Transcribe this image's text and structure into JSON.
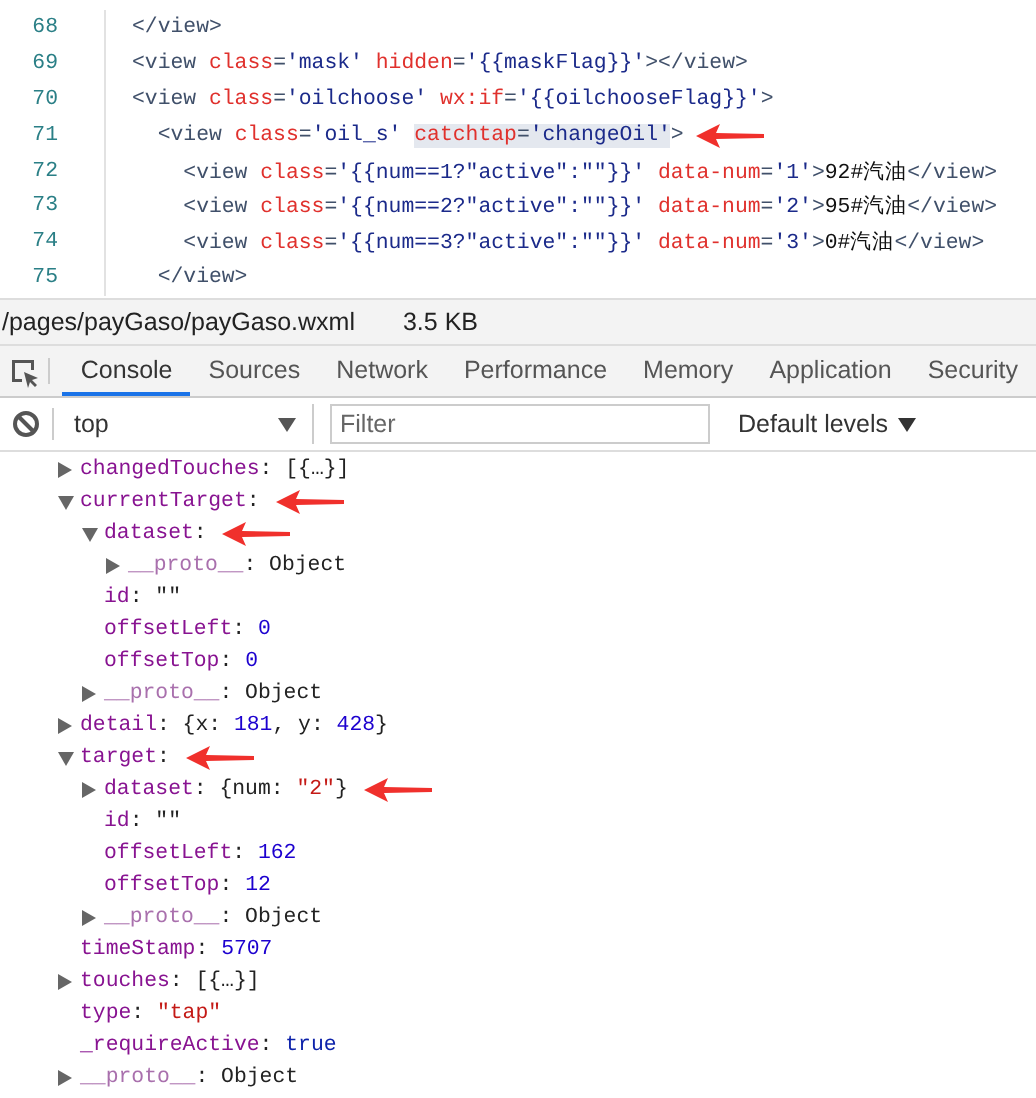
{
  "code_editor": {
    "lines": [
      {
        "number": "68",
        "marked": false,
        "tokens": [
          {
            "kind": "tag",
            "text": "</view>"
          }
        ]
      },
      {
        "number": "69",
        "marked": false,
        "tokens": [
          {
            "kind": "tag",
            "text": "<view "
          },
          {
            "kind": "attr",
            "text": "class"
          },
          {
            "kind": "tag",
            "text": "="
          },
          {
            "kind": "value",
            "text": "'mask' "
          },
          {
            "kind": "attr",
            "text": "hidden"
          },
          {
            "kind": "tag",
            "text": "="
          },
          {
            "kind": "value",
            "text": "'{{maskFlag}}'"
          },
          {
            "kind": "tag",
            "text": "></view>"
          }
        ]
      },
      {
        "number": "70",
        "marked": false,
        "tokens": [
          {
            "kind": "tag",
            "text": "<view "
          },
          {
            "kind": "attr",
            "text": "class"
          },
          {
            "kind": "tag",
            "text": "="
          },
          {
            "kind": "value",
            "text": "'oilchoose' "
          },
          {
            "kind": "attr",
            "text": "wx:if"
          },
          {
            "kind": "tag",
            "text": "="
          },
          {
            "kind": "value",
            "text": "'{{oilchooseFlag}}'"
          },
          {
            "kind": "tag",
            "text": ">"
          }
        ]
      },
      {
        "number": "71",
        "marked": true,
        "tokens": [
          {
            "kind": "tag",
            "text": "  <view "
          },
          {
            "kind": "attr",
            "text": "class"
          },
          {
            "kind": "tag",
            "text": "="
          },
          {
            "kind": "value",
            "text": "'oil_s' "
          },
          {
            "kind": "attr",
            "text": "catchtap",
            "highlighted": true
          },
          {
            "kind": "tag",
            "text": "=",
            "highlighted": true
          },
          {
            "kind": "value",
            "text": "'changeOil'",
            "highlighted": true
          },
          {
            "kind": "tag",
            "text": ">"
          }
        ]
      },
      {
        "number": "72",
        "marked": false,
        "tokens": [
          {
            "kind": "tag",
            "text": "    <view "
          },
          {
            "kind": "attr",
            "text": "class"
          },
          {
            "kind": "tag",
            "text": "="
          },
          {
            "kind": "value",
            "text": "'{{num==1?\"active\":\"\"}}' "
          },
          {
            "kind": "attr",
            "text": "data-num"
          },
          {
            "kind": "tag",
            "text": "="
          },
          {
            "kind": "value",
            "text": "'1'"
          },
          {
            "kind": "tag",
            "text": ">"
          },
          {
            "kind": "text",
            "text": "92#汽油"
          },
          {
            "kind": "tag",
            "text": "</view>"
          }
        ]
      },
      {
        "number": "73",
        "marked": false,
        "tokens": [
          {
            "kind": "tag",
            "text": "    <view "
          },
          {
            "kind": "attr",
            "text": "class"
          },
          {
            "kind": "tag",
            "text": "="
          },
          {
            "kind": "value",
            "text": "'{{num==2?\"active\":\"\"}}' "
          },
          {
            "kind": "attr",
            "text": "data-num"
          },
          {
            "kind": "tag",
            "text": "="
          },
          {
            "kind": "value",
            "text": "'2'"
          },
          {
            "kind": "tag",
            "text": ">"
          },
          {
            "kind": "text",
            "text": "95#汽油"
          },
          {
            "kind": "tag",
            "text": "</view>"
          }
        ]
      },
      {
        "number": "74",
        "marked": false,
        "tokens": [
          {
            "kind": "tag",
            "text": "    <view "
          },
          {
            "kind": "attr",
            "text": "class"
          },
          {
            "kind": "tag",
            "text": "="
          },
          {
            "kind": "value",
            "text": "'{{num==3?\"active\":\"\"}}' "
          },
          {
            "kind": "attr",
            "text": "data-num"
          },
          {
            "kind": "tag",
            "text": "="
          },
          {
            "kind": "value",
            "text": "'3'"
          },
          {
            "kind": "tag",
            "text": ">"
          },
          {
            "kind": "text",
            "text": "0#汽油"
          },
          {
            "kind": "tag",
            "text": "</view>"
          }
        ]
      },
      {
        "number": "75",
        "marked": false,
        "tokens": [
          {
            "kind": "tag",
            "text": "  </view>"
          }
        ]
      }
    ]
  },
  "file_bar": {
    "path": "/pages/payGaso/payGaso.wxml",
    "size": "3.5 KB"
  },
  "tabs": [
    {
      "label": "Console",
      "selected": true
    },
    {
      "label": "Sources",
      "selected": false
    },
    {
      "label": "Network",
      "selected": false
    },
    {
      "label": "Performance",
      "selected": false
    },
    {
      "label": "Memory",
      "selected": false
    },
    {
      "label": "Application",
      "selected": false
    },
    {
      "label": "Security",
      "selected": false
    }
  ],
  "toolbar": {
    "context": "top",
    "filter_placeholder": "Filter",
    "levels": "Default levels"
  },
  "console": [
    {
      "key": "changedTouches",
      "kind": "own",
      "expanded": false,
      "marked": false,
      "value": [
        {
          "kind": "plain",
          "text": ": [{…}]"
        }
      ]
    },
    {
      "key": "currentTarget",
      "kind": "own",
      "expanded": true,
      "marked": true,
      "value": [
        {
          "kind": "plain",
          "text": ":"
        }
      ],
      "children": [
        {
          "key": "dataset",
          "kind": "own",
          "expanded": true,
          "marked": true,
          "value": [
            {
              "kind": "plain",
              "text": ":"
            }
          ],
          "children": [
            {
              "key": "__proto__",
              "kind": "proto",
              "expanded": false,
              "marked": false,
              "value": [
                {
                  "kind": "plain",
                  "text": ": Object"
                }
              ]
            }
          ]
        },
        {
          "key": "id",
          "kind": "own",
          "marked": false,
          "value": [
            {
              "kind": "plain",
              "text": ": \"\""
            }
          ]
        },
        {
          "key": "offsetLeft",
          "kind": "own",
          "marked": false,
          "value": [
            {
              "kind": "plain",
              "text": ": "
            },
            {
              "kind": "number",
              "text": "0"
            }
          ]
        },
        {
          "key": "offsetTop",
          "kind": "own",
          "marked": false,
          "value": [
            {
              "kind": "plain",
              "text": ": "
            },
            {
              "kind": "number",
              "text": "0"
            }
          ]
        },
        {
          "key": "__proto__",
          "kind": "proto",
          "expanded": false,
          "marked": false,
          "value": [
            {
              "kind": "plain",
              "text": ": Object"
            }
          ]
        }
      ]
    },
    {
      "key": "detail",
      "kind": "own",
      "expanded": false,
      "marked": false,
      "value": [
        {
          "kind": "plain",
          "text": ": {x: "
        },
        {
          "kind": "number",
          "text": "181"
        },
        {
          "kind": "plain",
          "text": ", y: "
        },
        {
          "kind": "number",
          "text": "428"
        },
        {
          "kind": "plain",
          "text": "}"
        }
      ]
    },
    {
      "key": "target",
      "kind": "own",
      "expanded": true,
      "marked": true,
      "value": [
        {
          "kind": "plain",
          "text": ":"
        }
      ],
      "children": [
        {
          "key": "dataset",
          "kind": "own",
          "expanded": false,
          "marked": true,
          "value": [
            {
              "kind": "plain",
              "text": ": {num: "
            },
            {
              "kind": "string",
              "text": "\"2\""
            },
            {
              "kind": "plain",
              "text": "}"
            }
          ]
        },
        {
          "key": "id",
          "kind": "own",
          "marked": false,
          "value": [
            {
              "kind": "plain",
              "text": ": \"\""
            }
          ]
        },
        {
          "key": "offsetLeft",
          "kind": "own",
          "marked": false,
          "value": [
            {
              "kind": "plain",
              "text": ": "
            },
            {
              "kind": "number",
              "text": "162"
            }
          ]
        },
        {
          "key": "offsetTop",
          "kind": "own",
          "marked": false,
          "value": [
            {
              "kind": "plain",
              "text": ": "
            },
            {
              "kind": "number",
              "text": "12"
            }
          ]
        },
        {
          "key": "__proto__",
          "kind": "proto",
          "expanded": false,
          "marked": false,
          "value": [
            {
              "kind": "plain",
              "text": ": Object"
            }
          ]
        }
      ]
    },
    {
      "key": "timeStamp",
      "kind": "own",
      "marked": false,
      "value": [
        {
          "kind": "plain",
          "text": ": "
        },
        {
          "kind": "number",
          "text": "5707"
        }
      ]
    },
    {
      "key": "touches",
      "kind": "own",
      "expanded": false,
      "marked": false,
      "value": [
        {
          "kind": "plain",
          "text": ": [{…}]"
        }
      ]
    },
    {
      "key": "type",
      "kind": "own",
      "marked": false,
      "value": [
        {
          "kind": "plain",
          "text": ": "
        },
        {
          "kind": "string",
          "text": "\"tap\""
        }
      ]
    },
    {
      "key": "_requireActive",
      "kind": "own",
      "marked": false,
      "value": [
        {
          "kind": "plain",
          "text": ": "
        },
        {
          "kind": "keyword",
          "text": "true"
        }
      ]
    },
    {
      "key": "__proto__",
      "kind": "proto",
      "expanded": false,
      "marked": false,
      "value": [
        {
          "kind": "plain",
          "text": ": Object"
        }
      ]
    }
  ]
}
